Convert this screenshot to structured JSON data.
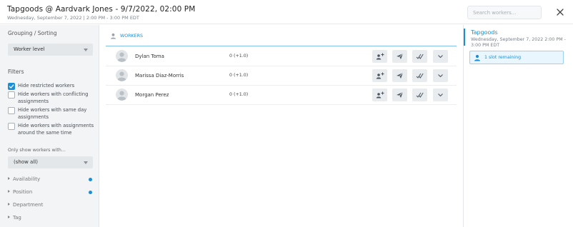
{
  "header": {
    "title": "Tapgoods @ Aardvark Jones - 9/7/2022, 02:00 PM",
    "subtitle": "Wednesday, September 7, 2022 | 2:00 PM - 3:00 PM EDT",
    "search_placeholder": "Search workers...",
    "close_icon": "close-icon"
  },
  "sidebar": {
    "grouping_title": "Grouping / Sorting",
    "grouping_value": "Worker level",
    "filters_title": "Filters",
    "filters": [
      {
        "label": "Hide restricted workers",
        "checked": true
      },
      {
        "label": "Hide workers with conflicting assignments",
        "checked": false
      },
      {
        "label": "Hide workers with same day assignments",
        "checked": false
      },
      {
        "label": "Hide workers with assignments around the same time",
        "checked": false
      }
    ],
    "only_show_label": "Only show workers with...",
    "only_show_value": "(show all)",
    "sections": [
      {
        "label": "Availability",
        "dot": true
      },
      {
        "label": "Position",
        "dot": true
      },
      {
        "label": "Department",
        "dot": false
      },
      {
        "label": "Tag",
        "dot": false
      }
    ],
    "accent_color": "#1b8fd6"
  },
  "main": {
    "tab_label": "WORKERS",
    "workers": [
      {
        "name": "Dylan Toma",
        "hours": "0 (+1.0)"
      },
      {
        "name": "Marissa Diaz-Morris",
        "hours": "0 (+1.0)"
      },
      {
        "name": "Morgan Perez",
        "hours": "0 (+1.0)"
      }
    ],
    "row_actions": [
      "add-person-icon",
      "send-icon",
      "double-check-icon",
      "chevron-down-icon"
    ]
  },
  "panel": {
    "title": "Tapgoods",
    "date": "Wednesday, September 7, 2022 2:00 PM - 3:00 PM EDT",
    "slot_label": "1 slot remaining"
  }
}
